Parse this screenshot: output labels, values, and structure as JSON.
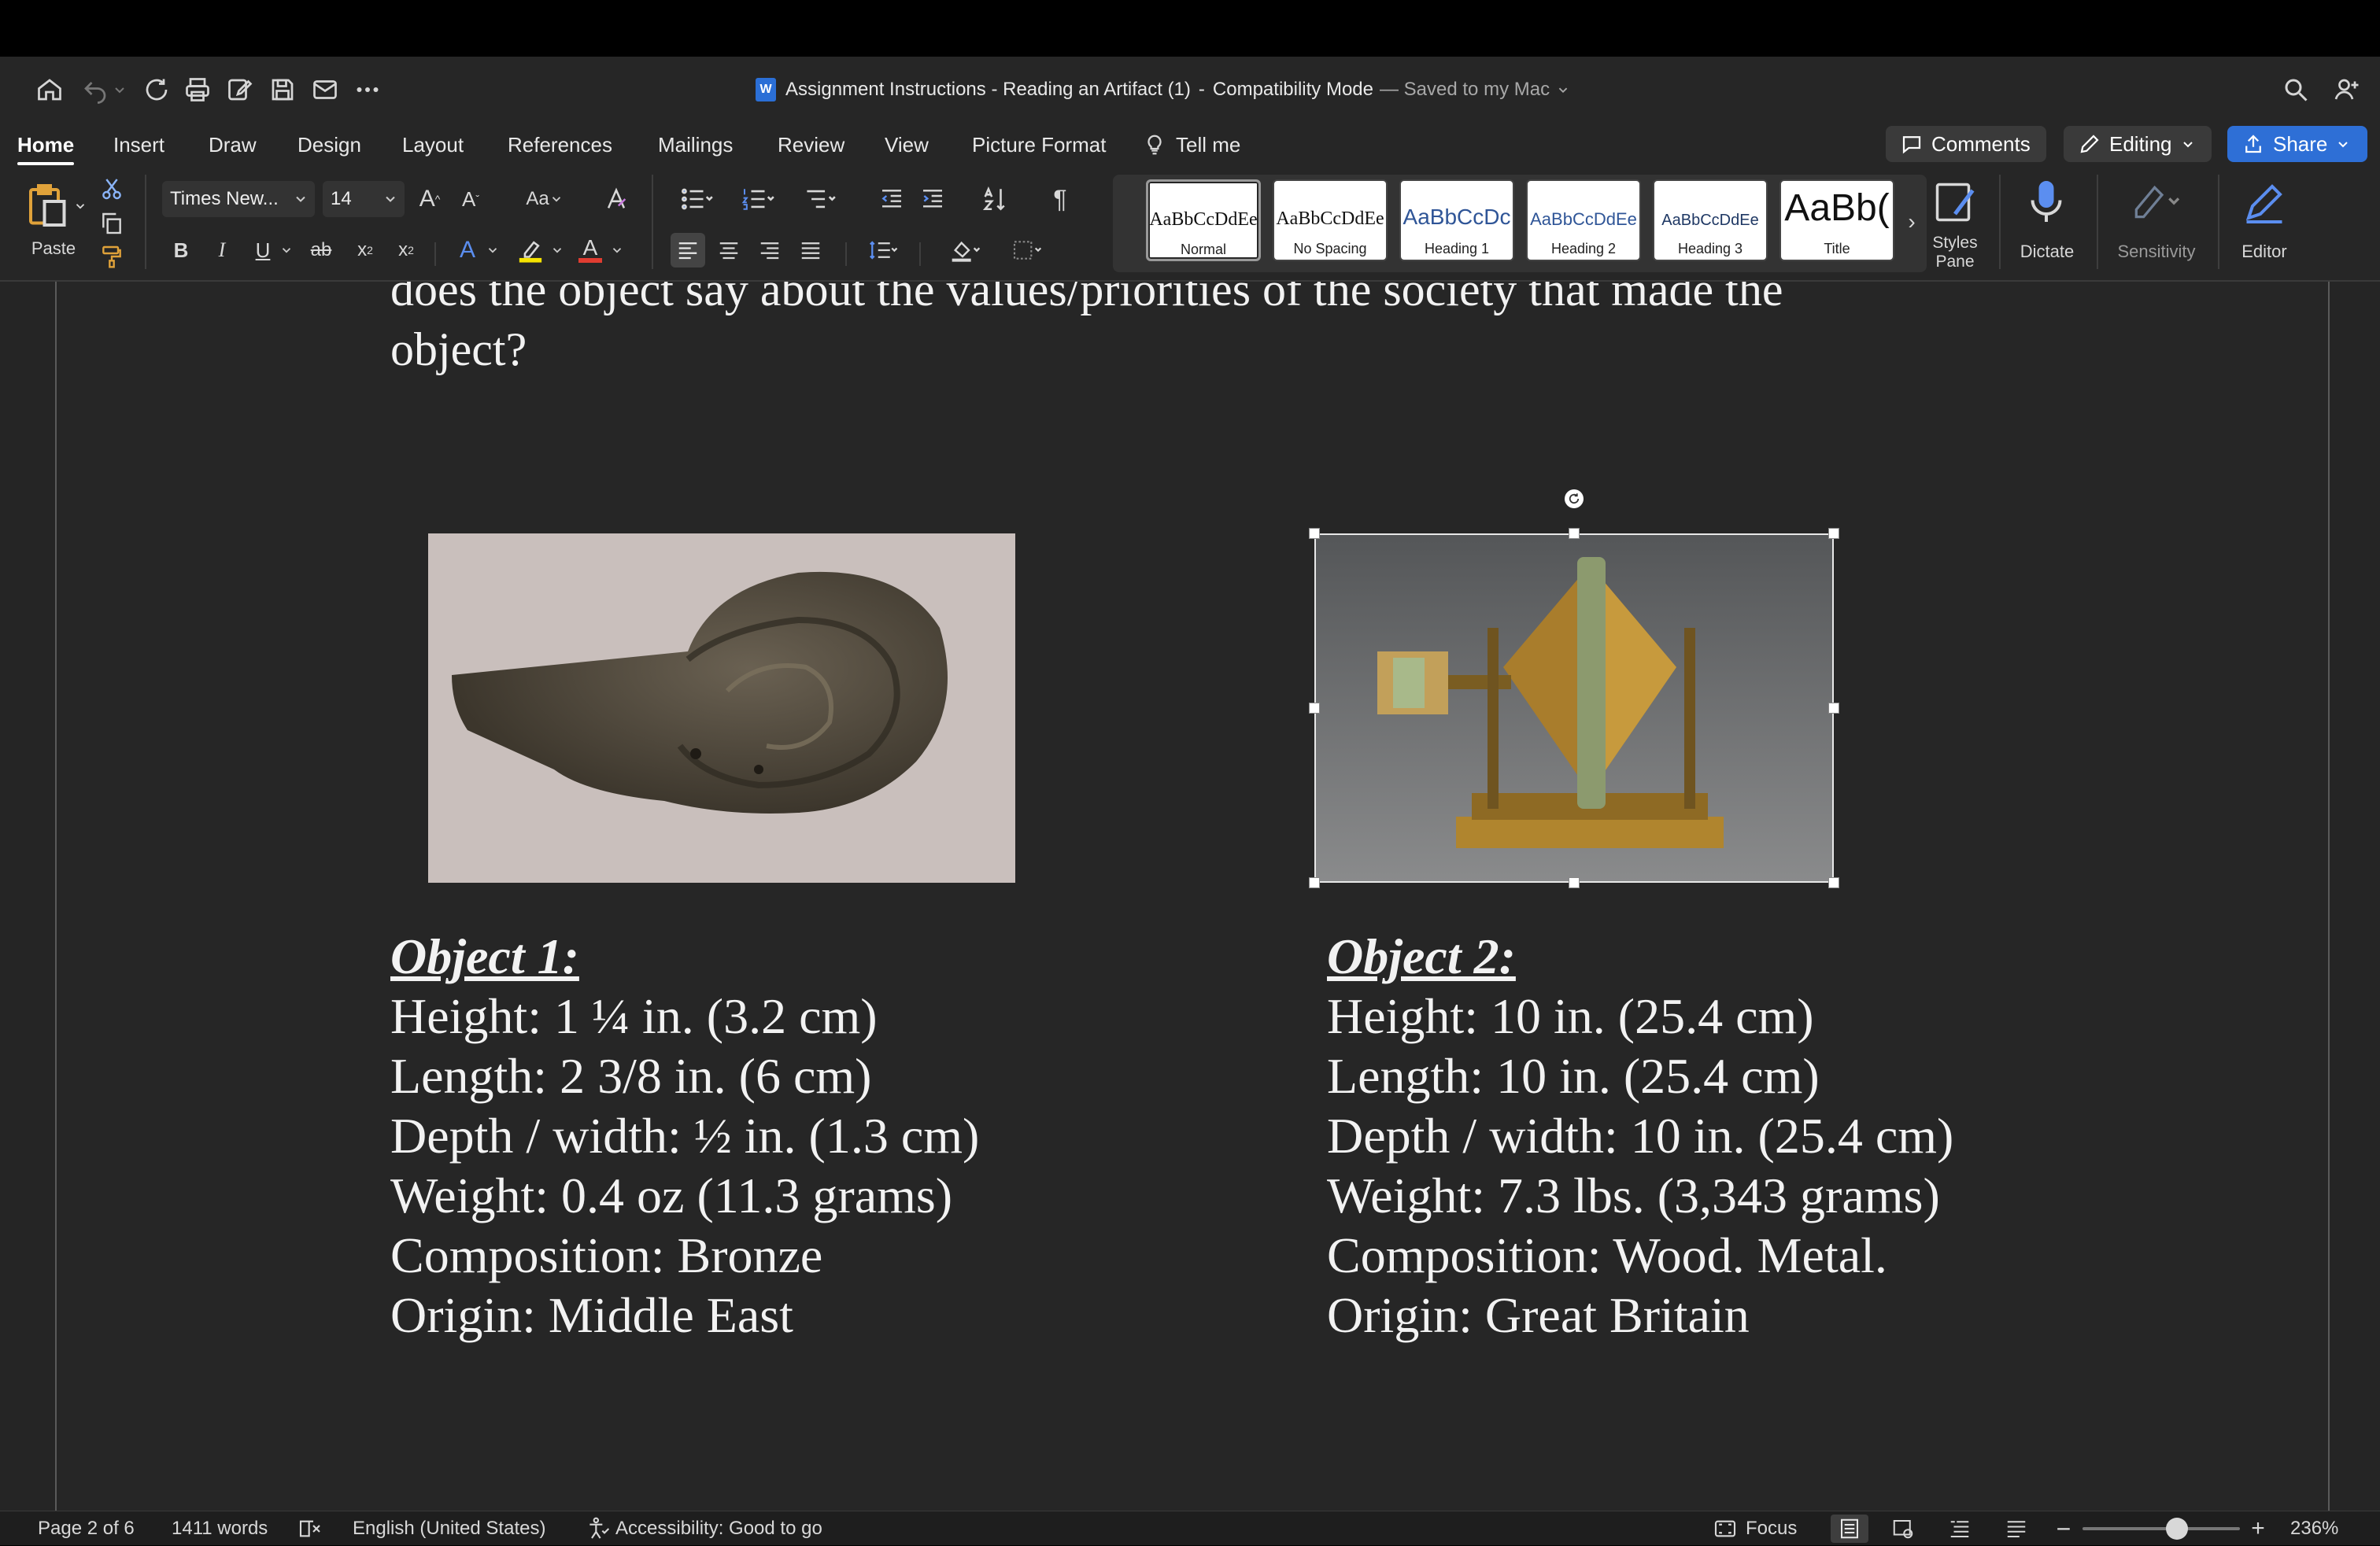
{
  "window": {
    "title": "Assignment Instructions - Reading an Artifact (1)",
    "mode": "Compatibility Mode",
    "saved": "— Saved to my Mac",
    "doc_icon": "W"
  },
  "tabs": [
    "Home",
    "Insert",
    "Draw",
    "Design",
    "Layout",
    "References",
    "Mailings",
    "Review",
    "View",
    "Picture Format"
  ],
  "tell_me": "Tell me",
  "header_buttons": {
    "comments": "Comments",
    "editing": "Editing",
    "share": "Share"
  },
  "ribbon": {
    "paste": "Paste",
    "font_name": "Times New...",
    "font_size": "14",
    "change_case": "Aa",
    "styles": [
      {
        "preview": "AaBbCcDdEe",
        "name": "Normal"
      },
      {
        "preview": "AaBbCcDdEe",
        "name": "No Spacing"
      },
      {
        "preview": "AaBbCcDc",
        "name": "Heading 1"
      },
      {
        "preview": "AaBbCcDdEe",
        "name": "Heading 2"
      },
      {
        "preview": "AaBbCcDdEe",
        "name": "Heading 3"
      },
      {
        "preview": "AaBb(",
        "name": "Title"
      }
    ],
    "styles_pane_1": "Styles",
    "styles_pane_2": "Pane",
    "dictate": "Dictate",
    "sensitivity": "Sensitivity",
    "editor": "Editor"
  },
  "document": {
    "line1": "does the object say about the values/priorities of the society that made the",
    "line2": "object?",
    "object1": {
      "heading": "Object 1:",
      "lines": [
        "Height: 1 ¼ in. (3.2 cm)",
        "Length: 2 3/8 in. (6 cm)",
        "Depth / width: ½ in. (1.3 cm)",
        "Weight: 0.4 oz (11.3 grams)",
        "Composition: Bronze",
        "Origin: Middle East"
      ]
    },
    "object2": {
      "heading": "Object 2:",
      "lines": [
        "Height: 10 in. (25.4 cm)",
        "Length: 10 in. (25.4 cm)",
        "Depth / width: 10 in. (25.4 cm)",
        "Weight: 7.3 lbs. (3,343 grams)",
        "Composition: Wood. Metal.",
        "Origin: Great Britain"
      ]
    }
  },
  "status": {
    "page": "Page 2 of 6",
    "words": "1411 words",
    "language": "English (United States)",
    "accessibility": "Accessibility: Good to go",
    "focus": "Focus",
    "zoom": "236%",
    "zoom_level": 0.6
  },
  "colors": {
    "accent": "#2e6fd6",
    "font_highlight": "#f5e300",
    "font_color": "#e03c31"
  }
}
